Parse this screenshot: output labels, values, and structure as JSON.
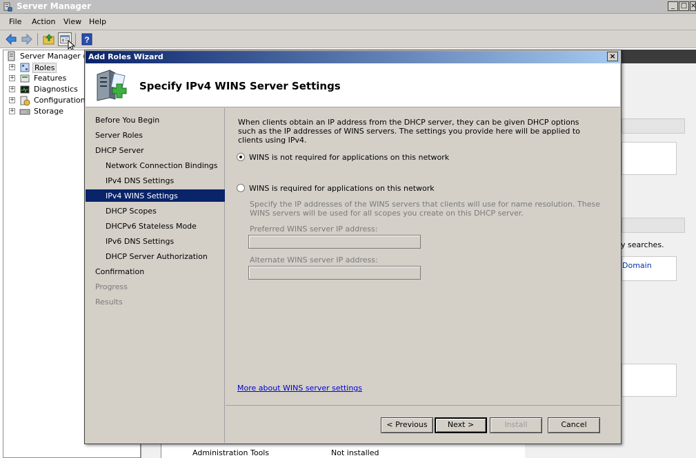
{
  "window": {
    "title": "Server Manager",
    "minimize": "_",
    "maximize": "□",
    "close": "×"
  },
  "menu": [
    "File",
    "Action",
    "View",
    "Help"
  ],
  "tree": {
    "root": "Server Manager (S",
    "items": [
      "Roles",
      "Features",
      "Diagnostics",
      "Configuration",
      "Storage"
    ],
    "expand_symbol": "+"
  },
  "background": {
    "searches_text": "y searches.",
    "domain_link": "Domain",
    "footer": {
      "label": "Administration Tools",
      "status": "Not installed"
    }
  },
  "dialog": {
    "title": "Add Roles Wizard",
    "close_symbol": "×",
    "heading": "Specify IPv4 WINS Server Settings",
    "steps": [
      {
        "label": "Before You Begin",
        "indent": 0,
        "state": "normal"
      },
      {
        "label": "Server Roles",
        "indent": 0,
        "state": "normal"
      },
      {
        "label": "DHCP Server",
        "indent": 0,
        "state": "normal"
      },
      {
        "label": "Network Connection Bindings",
        "indent": 1,
        "state": "normal"
      },
      {
        "label": "IPv4 DNS Settings",
        "indent": 1,
        "state": "normal"
      },
      {
        "label": "IPv4 WINS Settings",
        "indent": 1,
        "state": "selected"
      },
      {
        "label": "DHCP Scopes",
        "indent": 1,
        "state": "normal"
      },
      {
        "label": "DHCPv6 Stateless Mode",
        "indent": 1,
        "state": "normal"
      },
      {
        "label": "IPv6 DNS Settings",
        "indent": 1,
        "state": "normal"
      },
      {
        "label": "DHCP Server Authorization",
        "indent": 1,
        "state": "normal"
      },
      {
        "label": "Confirmation",
        "indent": 0,
        "state": "normal"
      },
      {
        "label": "Progress",
        "indent": 0,
        "state": "disabled"
      },
      {
        "label": "Results",
        "indent": 0,
        "state": "disabled"
      }
    ],
    "description": "When clients obtain an IP address from the DHCP server, they can be given DHCP options such as the IP addresses of WINS servers. The settings you provide here will be applied to clients using IPv4.",
    "option_not_required": "WINS is not required for applications on this network",
    "option_required": "WINS is required for applications on this network",
    "selected_option": "not_required",
    "required_desc": "Specify the IP addresses of the WINS servers that clients will use for name resolution. These WINS servers will be used for all scopes you create on this DHCP server.",
    "preferred_label": "Preferred WINS server IP address:",
    "preferred_value": "",
    "alternate_label": "Alternate WINS server IP address:",
    "alternate_value": "",
    "more_link": "More about WINS server settings",
    "buttons": {
      "previous": "< Previous",
      "next": "Next >",
      "install": "Install",
      "cancel": "Cancel"
    }
  }
}
